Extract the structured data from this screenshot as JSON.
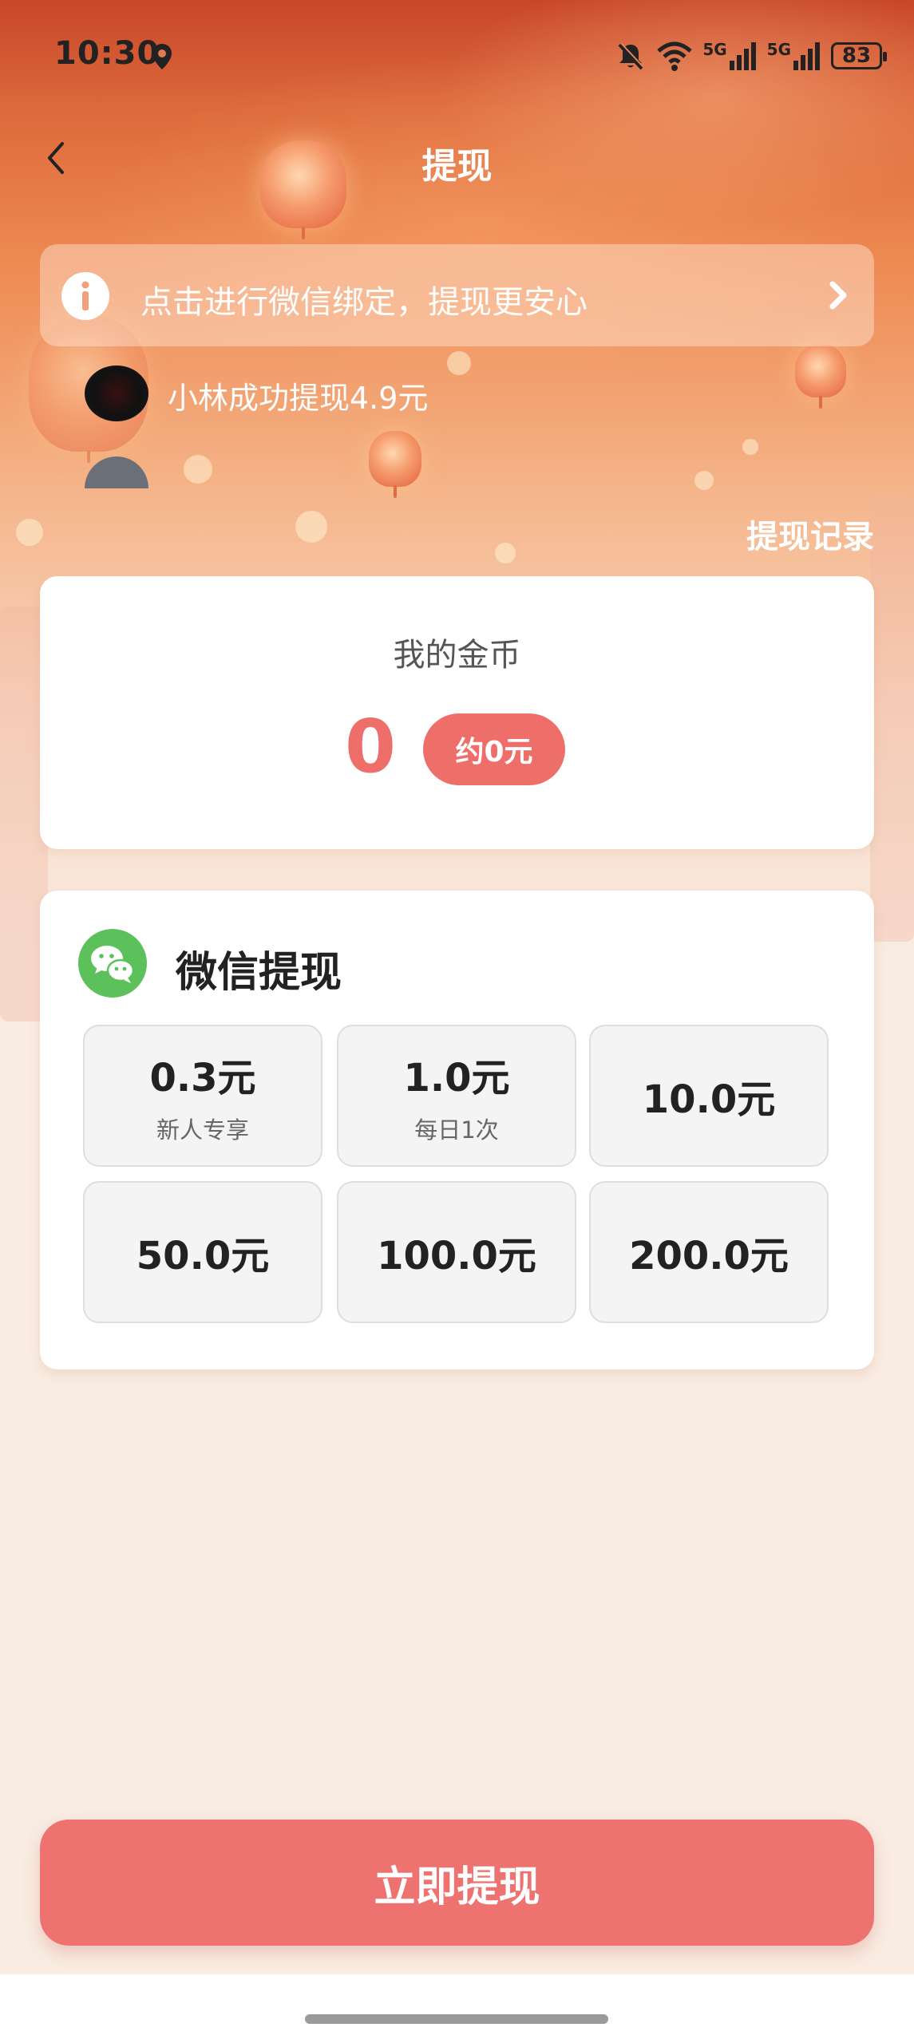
{
  "status_bar": {
    "time": "10:30",
    "network_1": "5G",
    "network_2": "5G",
    "battery": "83"
  },
  "header": {
    "title": "提现"
  },
  "notice": {
    "text": "点击进行微信绑定，提现更安心"
  },
  "ticker": {
    "text": "小林成功提现4.9元"
  },
  "records_link": "提现记录",
  "coins": {
    "label": "我的金币",
    "value": "0",
    "approx": "约0元"
  },
  "wechat": {
    "title": "微信提现",
    "options": [
      {
        "amount": "0.3元",
        "note": "新人专享"
      },
      {
        "amount": "1.0元",
        "note": "每日1次"
      },
      {
        "amount": "10.0元",
        "note": ""
      },
      {
        "amount": "50.0元",
        "note": ""
      },
      {
        "amount": "100.0元",
        "note": ""
      },
      {
        "amount": "200.0元",
        "note": ""
      }
    ]
  },
  "withdraw_button": "立即提现",
  "colors": {
    "accent": "#ee6f6a",
    "wechat_green": "#5cc15a"
  }
}
